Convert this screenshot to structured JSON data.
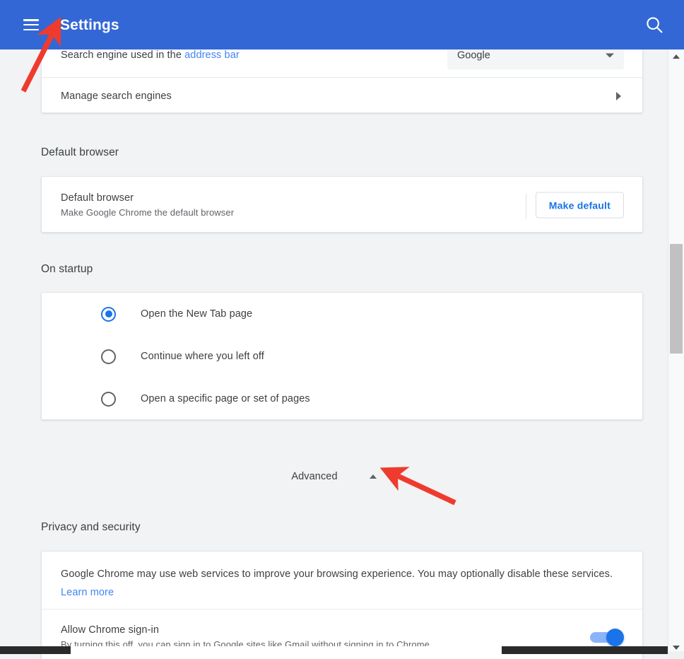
{
  "header": {
    "title": "Settings",
    "menu_icon": "hamburger-menu-icon",
    "search_icon": "search-icon"
  },
  "search_engine_section": {
    "rows": [
      {
        "label_prefix": "Search engine used in the ",
        "label_link": "address bar",
        "selected_value": "Google"
      },
      {
        "label": "Manage search engines",
        "chevron": "chevron-right-icon"
      }
    ]
  },
  "default_browser_section": {
    "title": "Default browser",
    "row_title": "Default browser",
    "row_subtitle": "Make Google Chrome the default browser",
    "button_label": "Make default"
  },
  "on_startup_section": {
    "title": "On startup",
    "options": [
      {
        "label": "Open the New Tab page",
        "selected": true
      },
      {
        "label": "Continue where you left off",
        "selected": false
      },
      {
        "label": "Open a specific page or set of pages",
        "selected": false
      }
    ]
  },
  "advanced": {
    "label": "Advanced",
    "chevron": "chevron-up-icon"
  },
  "privacy_section": {
    "title": "Privacy and security",
    "description_text": "Google Chrome may use web services to improve your browsing experience. You may optionally disable these services. ",
    "description_link": "Learn more",
    "signin_row": {
      "title": "Allow Chrome sign-in",
      "subtitle": "By turning this off, you can sign in to Google sites like Gmail without signing in to Chrome",
      "toggle_on": true
    }
  },
  "colors": {
    "header_blue": "#3367d6",
    "accent_blue": "#1a73e8",
    "link_blue": "#4285f4",
    "annotation_red": "#ef3b2d",
    "page_background": "#f1f3f4"
  }
}
